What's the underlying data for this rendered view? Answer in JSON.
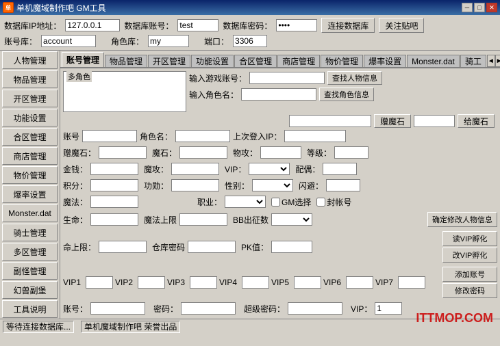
{
  "titleBar": {
    "iconText": "单",
    "title": "单机魔域制作吧 GM工具",
    "minBtn": "─",
    "maxBtn": "□",
    "closeBtn": "✕"
  },
  "menuBar": {
    "items": [
      "数据库IP地址：",
      "127.0.0.1",
      "数据库账号：",
      "test",
      "数据库密码：",
      "****",
      "端口：",
      "3306"
    ]
  },
  "topForm": {
    "dbIpLabel": "数据库IP地址：",
    "dbIpValue": "127.0.0.1",
    "dbAccountLabel": "数据库账号：",
    "dbAccountValue": "test",
    "dbPasswordLabel": "数据库密码：",
    "dbPasswordValue": "****",
    "connectBtn": "连接数据库",
    "followBtn": "关注贴吧",
    "dbLabel": "账号库：",
    "dbValue": "account",
    "roleDbLabel": "角色库：",
    "roleDbValue": "my",
    "portLabel": "端口：",
    "portValue": "3306"
  },
  "sidebar": {
    "items": [
      "人物管理",
      "物品管理",
      "开区管理",
      "功能设置",
      "合区管理",
      "商店管理",
      "物价管理",
      "爆率设置",
      "Monster.dat",
      "骑士管理",
      "多区管理",
      "副怪管理",
      "幻兽副堡",
      "工具说明"
    ]
  },
  "tabs": {
    "items": [
      "账号管理",
      "物品管理",
      "开区管理",
      "功能设置",
      "合区管理",
      "商店管理",
      "物价管理",
      "爆率设置",
      "Monster.dat",
      "骑工"
    ],
    "activeIndex": 0,
    "navLeft": "◄",
    "navRight": "►"
  },
  "accountTab": {
    "multiCharLabel": "多角色",
    "inputGameAccountLabel": "输入游戏账号：",
    "inputRoleNameLabel": "输入角色名：",
    "findPlayerBtn": "查找人物信息",
    "findRoleBtn": "查找角色信息",
    "giftMagicStoneLabel": "赠魔石",
    "giveMagicStoneBtn": "给魔石",
    "giftMagicStoneInput": "",
    "giveMagicStoneInput": "",
    "accountNumLabel": "账号",
    "roleNameLabel": "角色名：",
    "lastLoginIPLabel": "上次登入IP：",
    "accountNumInput": "",
    "roleNameInput": "",
    "lastLoginIPInput": "",
    "giftMagicStoneValLabel": "赠魔石：",
    "magicStoneLabel": "魔石：",
    "physicsAtkLabel": "物攻：",
    "levelLabel": "等级：",
    "giftMagicStoneVal": "",
    "magicStoneVal": "",
    "physicsAtkVal": "",
    "levelVal": "",
    "goldLabel": "金钱：",
    "magicAtkLabel": "魔攻：",
    "vipLabel": "VIP：",
    "spouseLabel": "配偶：",
    "goldVal": "",
    "magicAtkVal": "",
    "vipVal": "",
    "spouseVal": "",
    "pointsLabel": "积分：",
    "meritLabel": "功勋：",
    "genderLabel": "性别：",
    "flashLabel": "闪避：",
    "pointsVal": "",
    "meritVal": "",
    "genderVal": "",
    "flashVal": "",
    "magicLabel": "魔法：",
    "jobLabel": "职业：",
    "magicVal": "",
    "jobVal": "",
    "gmSelectLabel": "GM选择",
    "sealAccountLabel": "封帐号",
    "hpLabel": "生命：",
    "maxMagicLabel": "魔法上限",
    "bbExitCountLabel": "BB出征数",
    "hpVal": "",
    "maxMagicVal": "",
    "bbExitCountVal": "",
    "confirmModBtn": "确定修改人物信息",
    "maxHpLabel": "命上限：",
    "storagePassLabel": "仓库密码",
    "pkValLabel": "PK值：",
    "maxHpVal": "",
    "storagePassVal": "",
    "pkVal": "",
    "readVipBtn": "读VIP孵化",
    "changeVipBtn": "改VIP孵化",
    "addAccountBtn": "添加账号",
    "changePassBtn": "修改密码",
    "vip1Label": "VIP1",
    "vip2Label": "VIP2",
    "vip3Label": "VIP3",
    "vip4Label": "VIP4",
    "vip5Label": "VIP5",
    "vip6Label": "VIP6",
    "vip7Label": "VIP7",
    "vip1Val": "",
    "vip2Val": "",
    "vip3Val": "",
    "vip4Val": "",
    "vip5Val": "",
    "vip6Val": "",
    "vip7Val": "",
    "acctLabel": "账号：",
    "passwordLabel": "密码：",
    "superPassLabel": "超级密码：",
    "vipBotLabel": "VIP：",
    "acctVal": "",
    "passwordVal": "",
    "superPassVal": "",
    "vipBotVal": "1"
  },
  "statusBar": {
    "waitText": "等待连接数据库...",
    "creditText": "单机魔域制作吧 荣誉出品"
  },
  "watermark": "ITTMOP.COM"
}
